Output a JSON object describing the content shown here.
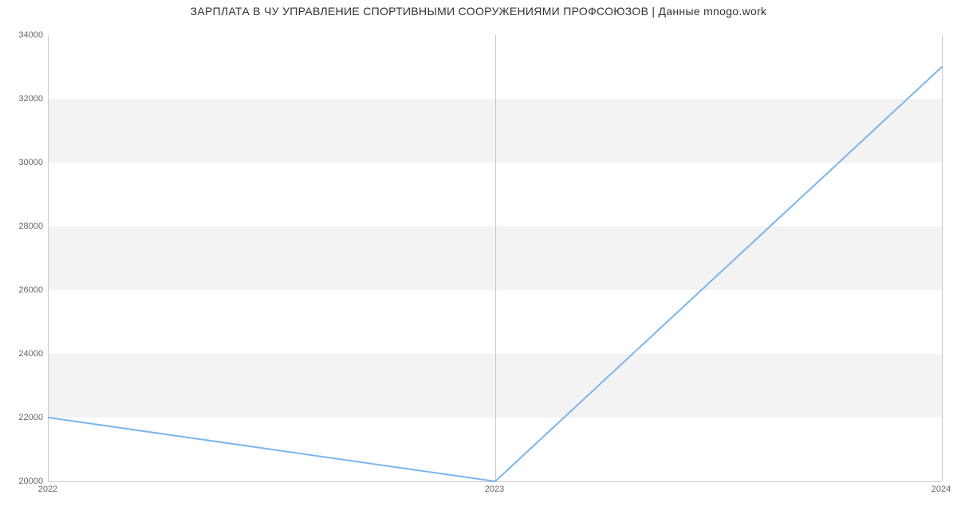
{
  "chart_data": {
    "type": "line",
    "title": "ЗАРПЛАТА В ЧУ  УПРАВЛЕНИЕ СПОРТИВНЫМИ СООРУЖЕНИЯМИ ПРОФСОЮЗОВ | Данные mnogo.work",
    "x": [
      "2022",
      "2023",
      "2024"
    ],
    "values": [
      22000,
      20000,
      33000
    ],
    "xlabel": "",
    "ylabel": "",
    "ylim": [
      20000,
      34000
    ],
    "y_ticks": [
      20000,
      22000,
      24000,
      26000,
      28000,
      30000,
      32000,
      34000
    ],
    "line_color": "#7cb5ec",
    "band_color": "#f3f3f3"
  }
}
